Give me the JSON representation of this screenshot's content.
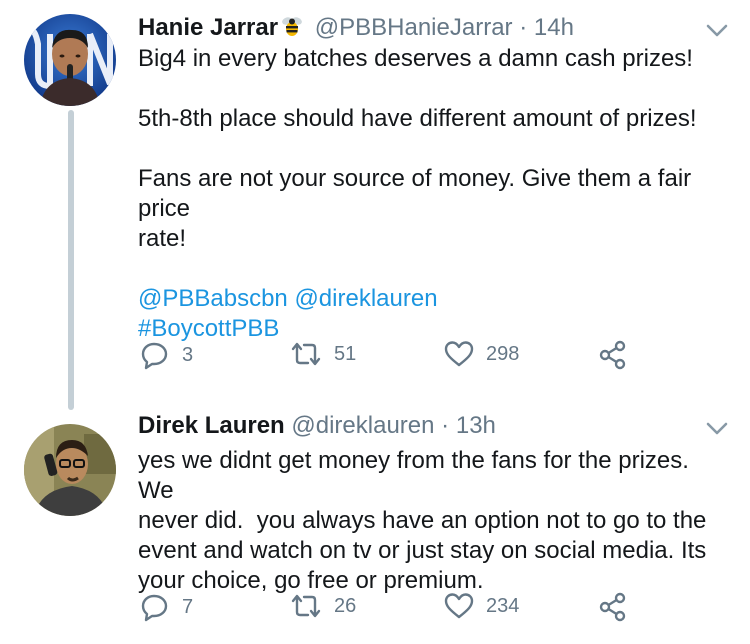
{
  "tweets": [
    {
      "name": "Hanie Jarrar",
      "handle": "@PBBHanieJarrar",
      "dot": "·",
      "time": "14h",
      "badge_icon": "bee-icon",
      "lines": [
        "Big4 in every batches deserves a damn cash prizes!",
        "",
        "5th-8th place should have different amount of prizes!",
        "",
        "Fans are not your source of money. Give them a fair price",
        "rate!",
        "",
        "@PBBabscbn @direklauren",
        "#BoycottPBB"
      ],
      "counts": {
        "replies": "3",
        "retweets": "51",
        "likes": "298"
      }
    },
    {
      "name": "Direk Lauren",
      "handle": "@direklauren",
      "dot": "·",
      "time": "13h",
      "lines": [
        "yes we didnt get money from the fans for the prizes. We",
        "never did.  you always have an option not to go to the",
        "event and watch on tv or just stay on social media. Its",
        "your choice, go free or premium."
      ],
      "counts": {
        "replies": "7",
        "retweets": "26",
        "likes": "234"
      }
    }
  ],
  "colors": {
    "link": "#1b95e0",
    "muted": "#657786",
    "text": "#14171a",
    "thread": "#c4cfd6"
  },
  "icons": [
    "reply-icon",
    "retweet-icon",
    "like-icon",
    "share-icon",
    "chevron-down-icon"
  ]
}
